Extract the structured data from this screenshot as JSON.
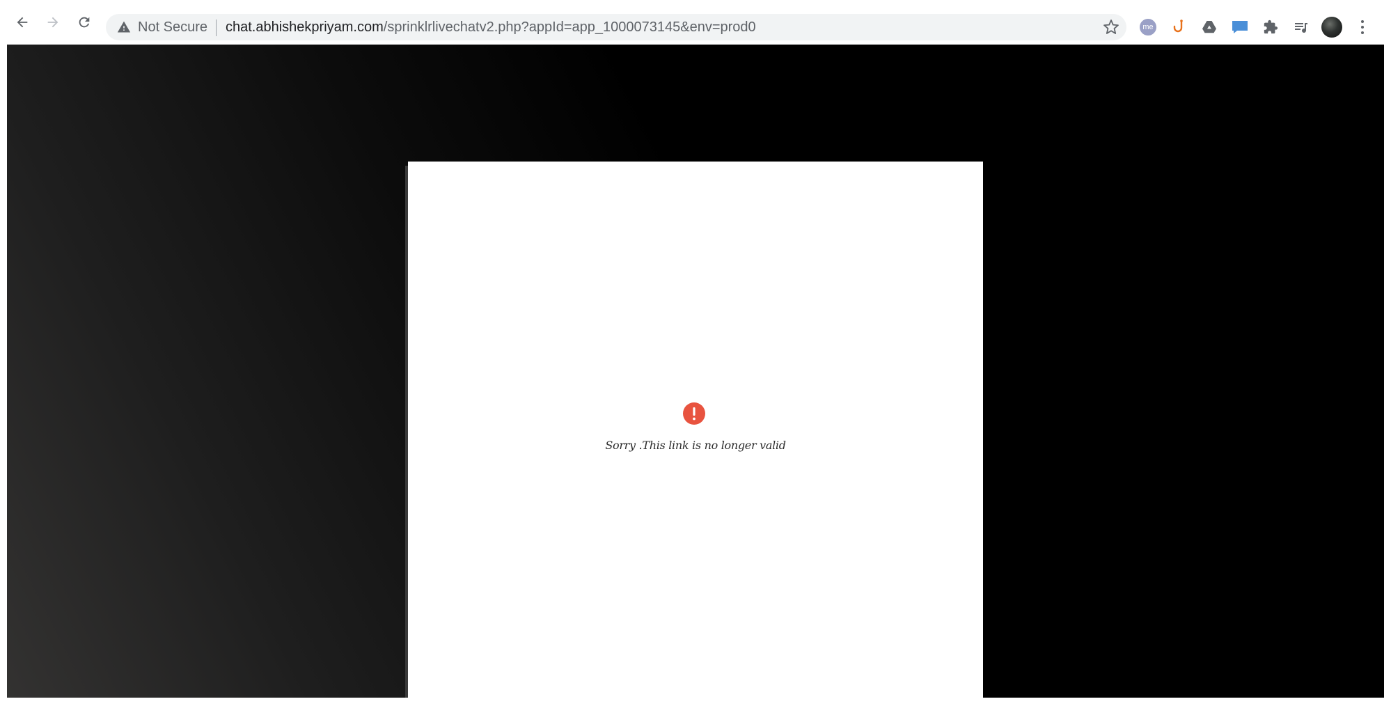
{
  "browser": {
    "security_label": "Not Secure",
    "url_host": "chat.abhishekpriyam.com",
    "url_path": "/sprinklrlivechatv2.php?appId=app_1000073145&env=prod0",
    "extensions": [
      {
        "name": "me-extension-icon",
        "label": "me"
      },
      {
        "name": "hook-extension-icon",
        "label": ""
      },
      {
        "name": "drive-extension-icon",
        "label": ""
      },
      {
        "name": "chat-extension-icon",
        "label": ""
      },
      {
        "name": "puzzle-extensions-icon",
        "label": ""
      },
      {
        "name": "reading-list-icon",
        "label": ""
      },
      {
        "name": "profile-avatar",
        "label": ""
      },
      {
        "name": "menu-icon",
        "label": ""
      }
    ]
  },
  "page": {
    "error_message": "Sorry .This link is no longer valid"
  },
  "colors": {
    "error_red": "#e8533f",
    "background": "#000000"
  }
}
